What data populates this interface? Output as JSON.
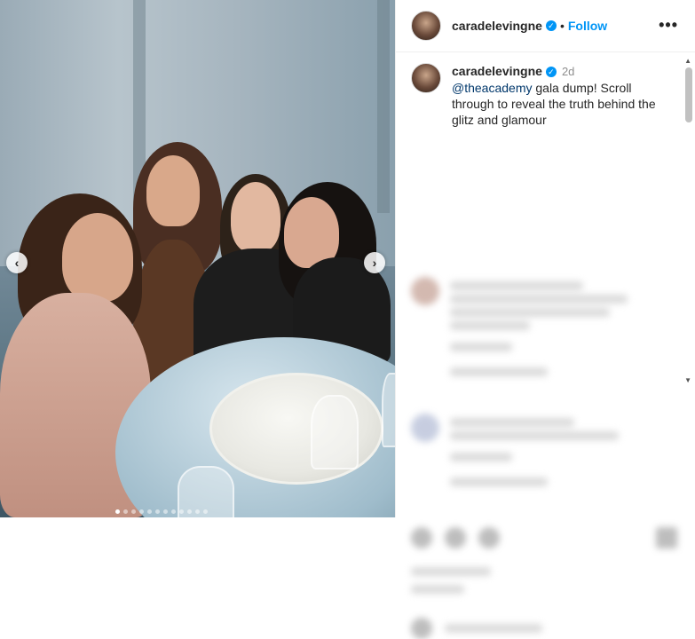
{
  "post": {
    "author": "caradelevingne",
    "follow_label": "Follow",
    "separator": "•",
    "more_label": "•••",
    "caption": {
      "author": "caradelevingne",
      "time": "2d",
      "mention": "@theacademy",
      "text": " gala dump! Scroll through to reveal the truth behind the glitz and glamour"
    }
  },
  "carousel": {
    "prev_label": "‹",
    "next_label": "›",
    "slide_count": 12,
    "active_slide": 0
  },
  "colors": {
    "accent": "#0095f6",
    "text": "#262626",
    "muted": "#8e8e8e",
    "mention": "#00376b"
  }
}
